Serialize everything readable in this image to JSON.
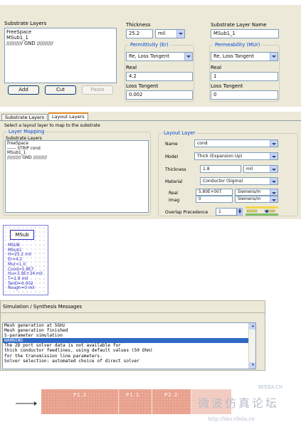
{
  "substrate_editor": {
    "layers_label": "Substrate Layers",
    "layers": [
      "FreeSpace",
      "MSub1_1",
      "////////// GND //////////"
    ],
    "add_label": "Add",
    "cut_label": "Cut",
    "paste_label": "Paste",
    "thickness_label": "Thickness",
    "thickness_value": "25.2",
    "thickness_unit": "mil",
    "layer_name_label": "Substrate Layer Name",
    "layer_name_value": "MSub1_1",
    "permittivity": {
      "title": "Permittivity (Er)",
      "type": "Re, Loss Tangent",
      "real_label": "Real",
      "real_value": "4.2",
      "loss_label": "Loss Tangent",
      "loss_value": "0.002"
    },
    "permeability": {
      "title": "Permeability (MUr)",
      "type": "Re, Loss Tangent",
      "real_label": "Real",
      "real_value": "1",
      "loss_label": "Loss Tangent",
      "loss_value": "0"
    }
  },
  "layout_layers": {
    "tabs": [
      "Substrate Layers",
      "Layout Layers"
    ],
    "instruction": "Select a layout layer to map to the substrate",
    "mapping_title": "Layer Mapping",
    "mapping_list_label": "Substrate Layers",
    "mapping_items": [
      "FreeSpace",
      "------ STRIP cond",
      "MSub1_1",
      "////////// GND //////////"
    ],
    "layout_layer_title": "Layout Layer",
    "name_label": "Name",
    "name_value": "cond",
    "model_label": "Model",
    "model_value": "Thick (Expansion Up)",
    "thickness_label": "Thickness",
    "thickness_value": "1.8",
    "thickness_unit": "mil",
    "material_label": "Material",
    "material_value": "Conductor (Sigma)",
    "real_label": "Real",
    "real_value": "5.80E+007",
    "real_unit": "Siemens/m",
    "imag_label": "Imag",
    "imag_value": "0",
    "imag_unit": "Siemens/m",
    "overlap_label": "Overlap Precedence",
    "overlap_value": "1"
  },
  "msub": {
    "title": "MSub",
    "lines": [
      "MSUB",
      "MSub1",
      "H=25.2 mil",
      "Er=4.2",
      "Mur=1.0",
      "Cond=5.8E7",
      "Hu=3.9E+34 mil",
      "T=1.8 mil",
      "TanD=0.002",
      "Rough=0 mil"
    ]
  },
  "messages": {
    "title": "Simulation / Synthesis Messages",
    "lines": [
      "Mesh generation at 5GHz",
      "Mesh generation finished",
      "S-parameter simulation",
      "WARNING",
      "The 2D port solver data is not available for",
      "thick conductor feedlines, using default values (50 Ohm)",
      "for the transmission line parameters.",
      "Solver selection: automated choice of direct solver"
    ],
    "highlighted_index": 3
  },
  "layout_strip": {
    "ports": [
      "P1.2",
      "P1.1",
      "P2.2"
    ],
    "watermark_site": "RFEDA.CN",
    "watermark_cn": "微波仿真论坛",
    "watermark_url": "http://bbs.rfeda.cn"
  }
}
